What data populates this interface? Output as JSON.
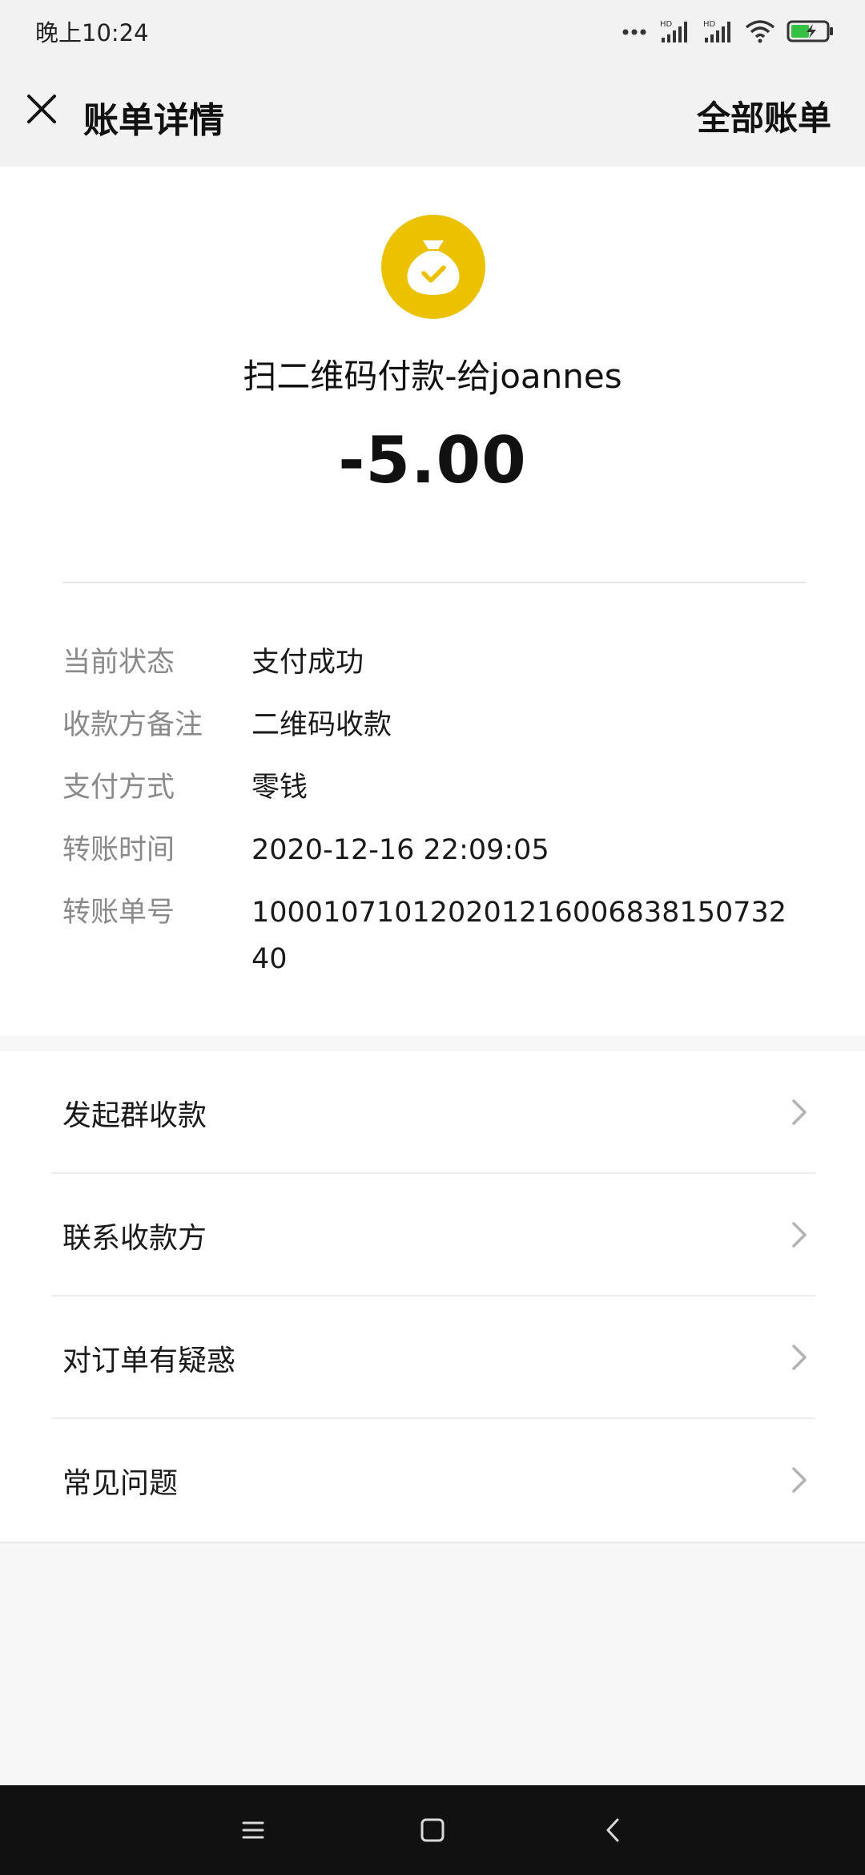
{
  "status_bar": {
    "time": "晚上10:24",
    "icons": [
      "more-dots-icon",
      "hd-signal-icon",
      "hd-signal-icon",
      "wifi-icon",
      "battery-charging-icon"
    ]
  },
  "header": {
    "title": "账单详情",
    "all_bills": "全部账单",
    "close_icon": "close-icon"
  },
  "payment": {
    "icon": "coin-bag-check-icon",
    "title": "扫二维码付款-给joannes",
    "amount": "-5.00",
    "accent_color": "#ebc100"
  },
  "details": [
    {
      "label": "当前状态",
      "value": "支付成功"
    },
    {
      "label": "收款方备注",
      "value": "二维码收款"
    },
    {
      "label": "支付方式",
      "value": "零钱"
    },
    {
      "label": "转账时间",
      "value": "2020-12-16 22:09:05"
    },
    {
      "label": "转账单号",
      "value": "100010710120201216006838150732 40"
    }
  ],
  "menu": [
    {
      "label": "发起群收款"
    },
    {
      "label": "联系收款方"
    },
    {
      "label": "对订单有疑惑"
    },
    {
      "label": "常见问题"
    }
  ],
  "nav_bar": {
    "icons": [
      "menu-icon",
      "home-square-icon",
      "back-icon"
    ]
  }
}
